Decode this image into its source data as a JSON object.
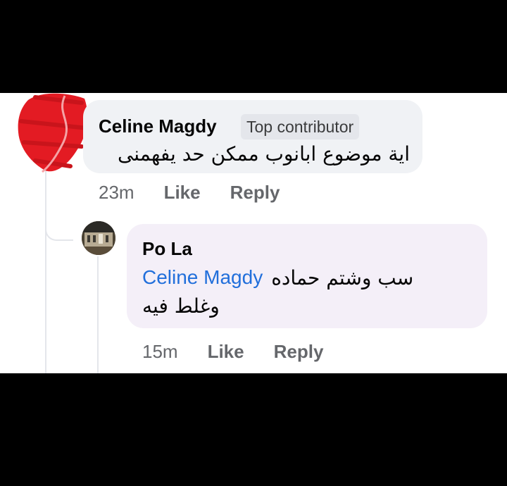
{
  "comments": [
    {
      "author": "Celine Magdy",
      "badge": "Top contributor",
      "text": "اية موضوع ابانوب ممكن حد يفهمنى",
      "time": "23m",
      "like_label": "Like",
      "reply_label": "Reply",
      "avatar": "redacted-scribble",
      "redaction_color": "#e31b23"
    }
  ],
  "reply": {
    "author": "Po La",
    "mention": "Celine Magdy",
    "text_line1": "سب وشتم حماده",
    "text_line2": "وغلط فيه",
    "time": "15m",
    "like_label": "Like",
    "reply_label": "Reply",
    "avatar": "building-photo-avatar"
  },
  "colors": {
    "bubble": "#f0f2f5",
    "mention": "#216fdb",
    "meta_text": "#65676b",
    "background_bars": "#000000"
  }
}
